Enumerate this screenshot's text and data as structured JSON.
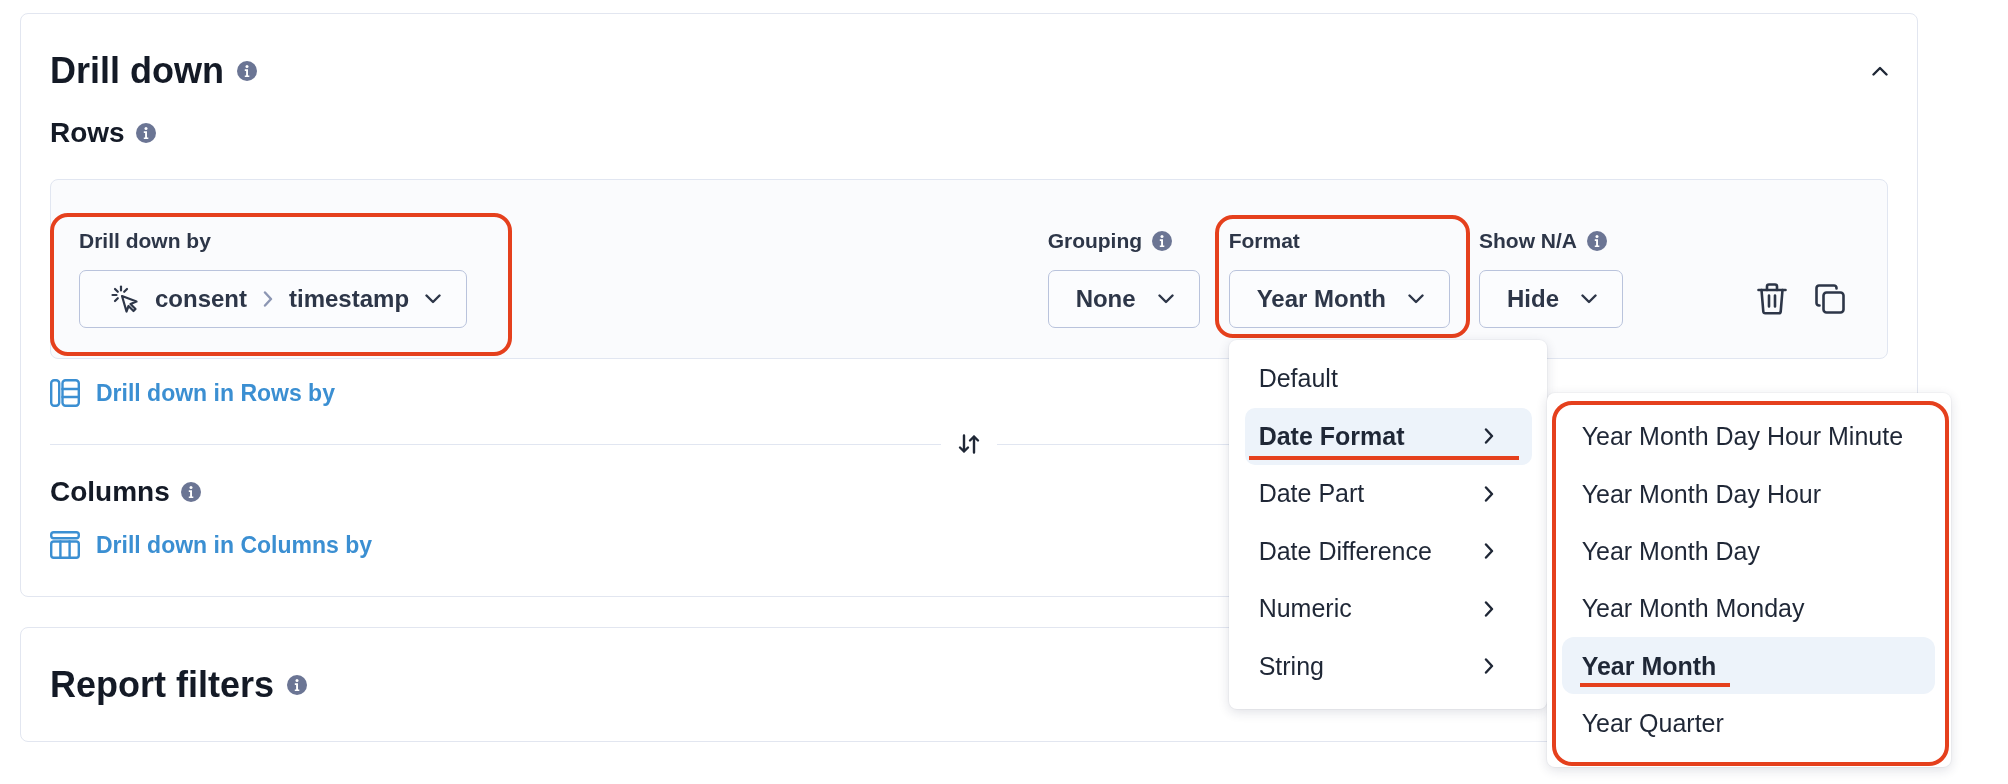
{
  "drill_down": {
    "title": "Drill down",
    "info": true,
    "expanded": true,
    "rows": {
      "title": "Rows",
      "info": true,
      "fields": [
        {
          "kind": "path",
          "label": "Drill down by",
          "info": false,
          "path": [
            "consent",
            "timestamp"
          ],
          "highlighted": true
        },
        {
          "kind": "select",
          "label": "Grouping",
          "info": true,
          "value": "None",
          "highlighted": false
        },
        {
          "kind": "select",
          "label": "Format",
          "info": false,
          "value": "Year Month",
          "highlighted": true,
          "menu": {
            "items": [
              {
                "label": "Default",
                "selected": false,
                "arrow": false,
                "underlined": false
              },
              {
                "label": "Date Format",
                "selected": true,
                "arrow": true,
                "underlined": true
              },
              {
                "label": "Date Part",
                "selected": false,
                "arrow": true,
                "underlined": false
              },
              {
                "label": "Date Difference",
                "selected": false,
                "arrow": true,
                "underlined": false
              },
              {
                "label": "Numeric",
                "selected": false,
                "arrow": true,
                "underlined": false
              },
              {
                "label": "String",
                "selected": false,
                "arrow": true,
                "underlined": false
              }
            ],
            "submenu": {
              "highlighted": true,
              "items": [
                {
                  "label": "Year Month Day Hour Minute",
                  "selected": false,
                  "underlined": false
                },
                {
                  "label": "Year Month Day Hour",
                  "selected": false,
                  "underlined": false
                },
                {
                  "label": "Year Month Day",
                  "selected": false,
                  "underlined": false
                },
                {
                  "label": "Year Month Monday",
                  "selected": false,
                  "underlined": false
                },
                {
                  "label": "Year Month",
                  "selected": true,
                  "underlined": true
                },
                {
                  "label": "Year Quarter",
                  "selected": false,
                  "underlined": false
                }
              ]
            }
          }
        },
        {
          "kind": "select",
          "label": "Show N/A",
          "info": true,
          "value": "Hide",
          "highlighted": false
        }
      ],
      "link": "Drill down in Rows by"
    },
    "columns": {
      "title": "Columns",
      "info": true,
      "link": "Drill down in Columns by"
    }
  },
  "report_filters": {
    "title": "Report filters",
    "info": true
  }
}
